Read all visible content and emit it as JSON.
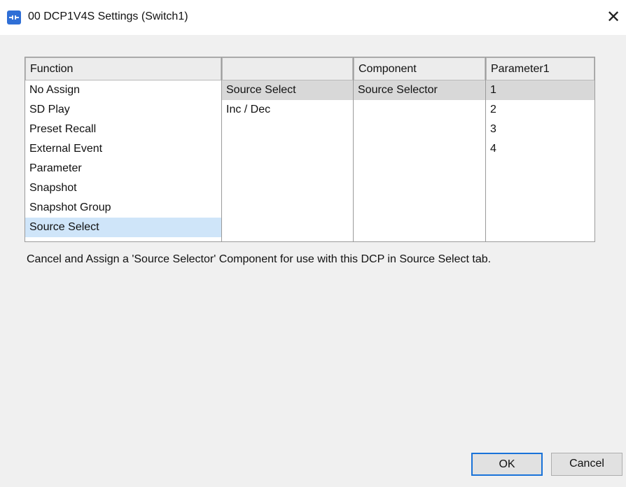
{
  "window": {
    "title": "00 DCP1V4S Settings (Switch1)",
    "close_glyph": "✕"
  },
  "table": {
    "headers": {
      "function": "Function",
      "sub": "",
      "component": "Component",
      "parameter1": "Parameter1"
    },
    "functions": [
      "No Assign",
      "SD Play",
      "Preset Recall",
      "External Event",
      "Parameter",
      "Snapshot",
      "Snapshot Group",
      "Source Select"
    ],
    "selected_function": "Source Select",
    "sub_items": [
      "Source Select",
      "Inc / Dec"
    ],
    "selected_sub": "Source Select",
    "components": [
      "Source Selector"
    ],
    "parameters": [
      "1",
      "2",
      "3",
      "4"
    ],
    "selected_parameter": "1"
  },
  "description": "Cancel and Assign a 'Source Selector' Component for use with this DCP in Source Select tab.",
  "buttons": {
    "ok": "OK",
    "cancel": "Cancel"
  },
  "colors": {
    "selection_focus": "#cfe5f9",
    "selection_inactive": "#d8d8d8",
    "default_button_border": "#1a73d9",
    "app_icon": "#2f6fd6"
  },
  "icons": {
    "app": "network-device-icon",
    "close": "close-icon"
  }
}
